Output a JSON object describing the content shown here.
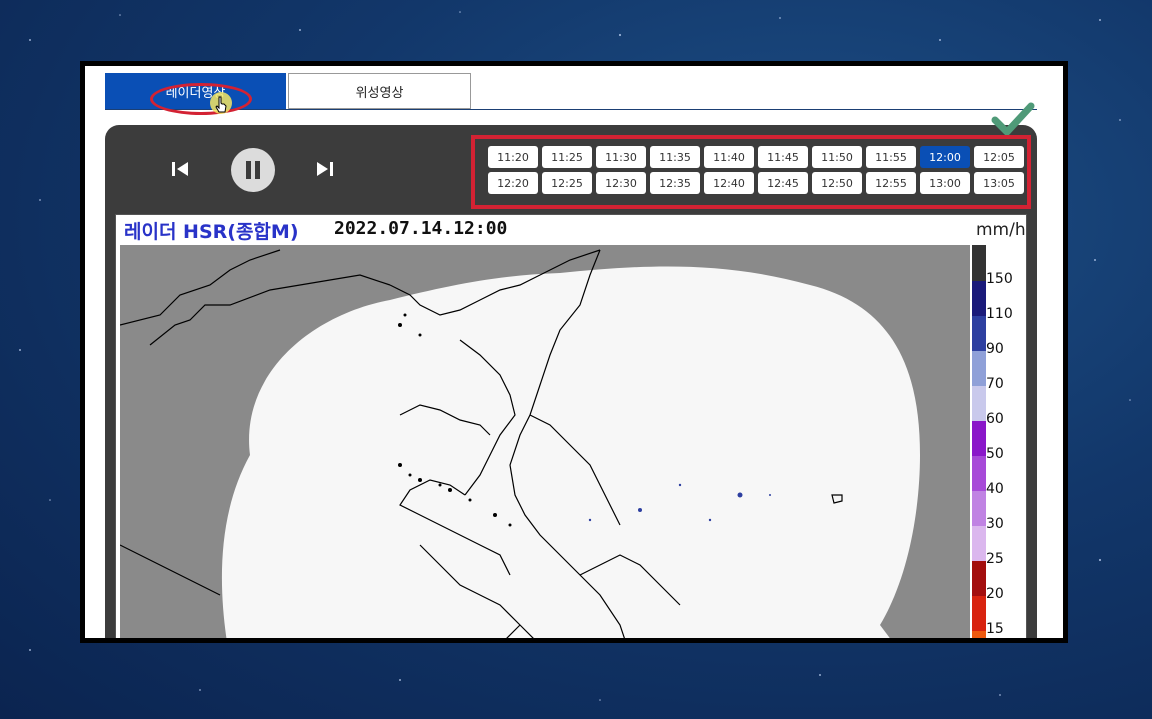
{
  "tabs": {
    "radar_label": "레이더영상",
    "satellite_label": "위성영상"
  },
  "controls": {
    "prev_icon": "skip-previous-icon",
    "pause_icon": "pause-icon",
    "next_icon": "skip-next-icon"
  },
  "times": {
    "row1": [
      "11:20",
      "11:25",
      "11:30",
      "11:35",
      "11:40",
      "11:45",
      "11:50",
      "11:55",
      "12:00",
      "12:05"
    ],
    "row2": [
      "12:20",
      "12:25",
      "12:30",
      "12:35",
      "12:40",
      "12:45",
      "12:50",
      "12:55",
      "13:00",
      "13:05"
    ],
    "selected": "12:00"
  },
  "map": {
    "title": "레이더 HSR(종합M)",
    "datetime": "2022.07.14.12:00",
    "unit": "mm/h",
    "legend": [
      {
        "label": "150",
        "color": "#1a1a7a"
      },
      {
        "label": "110",
        "color": "#2d3fa0"
      },
      {
        "label": "90",
        "color": "#8fa0d8"
      },
      {
        "label": "70",
        "color": "#c9c9ec"
      },
      {
        "label": "60",
        "color": "#8a17c9"
      },
      {
        "label": "50",
        "color": "#a74ad8"
      },
      {
        "label": "40",
        "color": "#c083e3"
      },
      {
        "label": "30",
        "color": "#dbb7ee"
      },
      {
        "label": "25",
        "color": "#a30e0e"
      },
      {
        "label": "20",
        "color": "#d8230f"
      },
      {
        "label": "15",
        "color": "#ee5a10"
      }
    ]
  },
  "colors": {
    "accent_blue": "#0a4fb5",
    "highlight_red": "#d32233",
    "check_green": "#4f9a78"
  }
}
